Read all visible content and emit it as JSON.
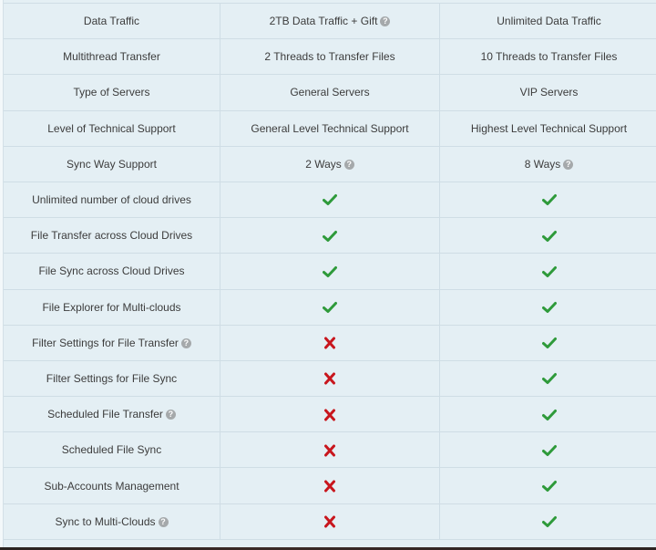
{
  "colors": {
    "background": "#e4eff4",
    "border": "#cfdde5",
    "text": "#3c3c3c",
    "check": "#2e9a3a",
    "cross": "#c8161d",
    "help_icon": "#a5a9ab"
  },
  "icons": {
    "help": "question-circle",
    "yes": "check-mark",
    "no": "cross-mark"
  },
  "rows": [
    {
      "feature": "Data Traffic",
      "feature_help": false,
      "free": {
        "type": "text",
        "text": "2TB Data Traffic + Gift",
        "help": true
      },
      "pro": {
        "type": "text",
        "text": "Unlimited Data Traffic",
        "help": false
      }
    },
    {
      "feature": "Multithread Transfer",
      "feature_help": false,
      "free": {
        "type": "text",
        "text": "2 Threads to Transfer Files",
        "help": false
      },
      "pro": {
        "type": "text",
        "text": "10 Threads to Transfer Files",
        "help": false
      }
    },
    {
      "feature": "Type of Servers",
      "feature_help": false,
      "free": {
        "type": "text",
        "text": "General Servers",
        "help": false
      },
      "pro": {
        "type": "text",
        "text": "VIP Servers",
        "help": false
      }
    },
    {
      "feature": "Level of Technical Support",
      "feature_help": false,
      "free": {
        "type": "text",
        "text": "General Level Technical Support",
        "help": false
      },
      "pro": {
        "type": "text",
        "text": "Highest Level Technical Support",
        "help": false
      }
    },
    {
      "feature": "Sync Way Support",
      "feature_help": false,
      "free": {
        "type": "text",
        "text": "2 Ways",
        "help": true
      },
      "pro": {
        "type": "text",
        "text": "8 Ways",
        "help": true
      }
    },
    {
      "feature": "Unlimited number of cloud drives",
      "feature_help": false,
      "free": {
        "type": "yes"
      },
      "pro": {
        "type": "yes"
      }
    },
    {
      "feature": "File Transfer across Cloud Drives",
      "feature_help": false,
      "free": {
        "type": "yes"
      },
      "pro": {
        "type": "yes"
      }
    },
    {
      "feature": "File Sync across Cloud Drives",
      "feature_help": false,
      "free": {
        "type": "yes"
      },
      "pro": {
        "type": "yes"
      }
    },
    {
      "feature": "File Explorer for Multi-clouds",
      "feature_help": false,
      "free": {
        "type": "yes"
      },
      "pro": {
        "type": "yes"
      }
    },
    {
      "feature": "Filter Settings for File Transfer",
      "feature_help": true,
      "free": {
        "type": "no"
      },
      "pro": {
        "type": "yes"
      }
    },
    {
      "feature": "Filter Settings for File Sync",
      "feature_help": false,
      "free": {
        "type": "no"
      },
      "pro": {
        "type": "yes"
      }
    },
    {
      "feature": "Scheduled File Transfer",
      "feature_help": true,
      "free": {
        "type": "no"
      },
      "pro": {
        "type": "yes"
      }
    },
    {
      "feature": "Scheduled File Sync",
      "feature_help": false,
      "free": {
        "type": "no"
      },
      "pro": {
        "type": "yes"
      }
    },
    {
      "feature": "Sub-Accounts Management",
      "feature_help": false,
      "free": {
        "type": "no"
      },
      "pro": {
        "type": "yes"
      }
    },
    {
      "feature": "Sync to Multi-Clouds",
      "feature_help": true,
      "free": {
        "type": "no"
      },
      "pro": {
        "type": "yes"
      }
    }
  ]
}
